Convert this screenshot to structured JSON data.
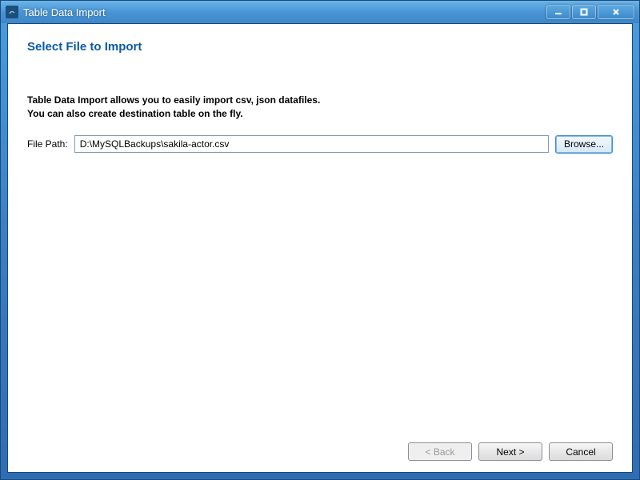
{
  "window": {
    "title": "Table Data Import"
  },
  "heading": "Select File to Import",
  "description": {
    "line1": "Table Data Import allows you to easily import csv, json datafiles.",
    "line2": "You can also create destination table on the fly."
  },
  "file": {
    "label": "File Path:",
    "value": "D:\\MySQLBackups\\sakila-actor.csv",
    "browse_label": "Browse..."
  },
  "footer": {
    "back_label": "< Back",
    "next_label": "Next >",
    "cancel_label": "Cancel"
  }
}
